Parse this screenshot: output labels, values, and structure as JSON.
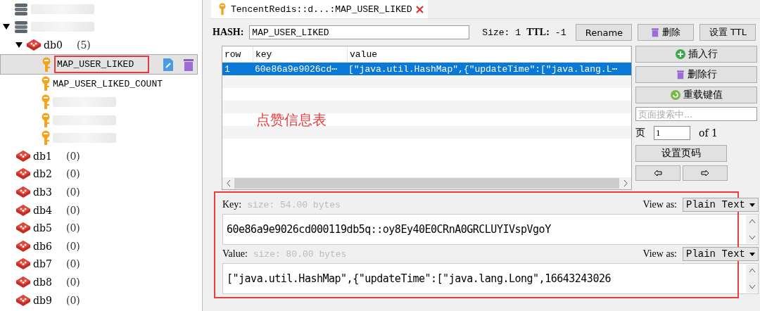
{
  "tree": [
    {
      "kind": "server"
    },
    {
      "kind": "server",
      "expanded": true,
      "children": [
        {
          "kind": "db",
          "label": "db0",
          "count": "(5)",
          "expanded": true,
          "children": [
            {
              "kind": "key",
              "label": "MAP_USER_LIKED",
              "selected": true
            },
            {
              "kind": "key",
              "label": "MAP_USER_LIKED_COUNT",
              "selected": false
            },
            {
              "kind": "key",
              "selected": false
            },
            {
              "kind": "key",
              "selected": false
            },
            {
              "kind": "key",
              "selected": false
            }
          ]
        },
        {
          "kind": "db",
          "label": "db1",
          "count": "(0)"
        },
        {
          "kind": "db",
          "label": "db2",
          "count": "(0)"
        },
        {
          "kind": "db",
          "label": "db3",
          "count": "(0)"
        },
        {
          "kind": "db",
          "label": "db4",
          "count": "(0)"
        },
        {
          "kind": "db",
          "label": "db5",
          "count": "(0)"
        },
        {
          "kind": "db",
          "label": "db6",
          "count": "(0)"
        },
        {
          "kind": "db",
          "label": "db7",
          "count": "(0)"
        },
        {
          "kind": "db",
          "label": "db8",
          "count": "(0)"
        },
        {
          "kind": "db",
          "label": "db9",
          "count": "(0)"
        }
      ]
    }
  ],
  "tab": {
    "title": "TencentRedis::d...:MAP_USER_LIKED"
  },
  "header": {
    "type_label": "HASH:",
    "name": "MAP_USER_LIKED",
    "size_label": "Size:",
    "size": "1",
    "ttl_label": "TTL:",
    "ttl": "-1",
    "buttons": [
      {
        "kind": "plain",
        "label": "Rename"
      },
      {
        "kind": "delete",
        "label": "删除"
      },
      {
        "kind": "plain",
        "label": "设置 TTL"
      }
    ]
  },
  "table": {
    "columns": [
      "row",
      "key",
      "value"
    ],
    "rows": [
      {
        "cells": [
          "1",
          "60e86a9e9026cd⋯",
          "[\"java.util.HashMap\",{\"updateTime\":[\"java.lang.L⋯"
        ],
        "selected": true
      }
    ]
  },
  "annotation": "点赞信息表",
  "side": {
    "buttons": [
      {
        "kind": "add",
        "label": "插入行"
      },
      {
        "kind": "delete",
        "label": "删除行"
      },
      {
        "kind": "reload",
        "label": "重载键值"
      }
    ],
    "search_placeholder": "页面搜索中...",
    "page_label": "页",
    "page": "1",
    "of": "of 1",
    "set_page": "设置页码"
  },
  "key_panel": {
    "label": "Key:",
    "size": "size: 54.00 bytes",
    "view_as": "View as:",
    "format": "Plain Text",
    "value": "60e86a9e9026cd000119db5q::oy8Ey40E0CRnA0GRCLUYIVspVgoY"
  },
  "value_panel": {
    "label": "Value:",
    "size": "size: 80.00 bytes",
    "view_as": "View as:",
    "format": "Plain Text",
    "value": "[\"java.util.HashMap\",{\"updateTime\":[\"java.lang.Long\",16643243026"
  }
}
